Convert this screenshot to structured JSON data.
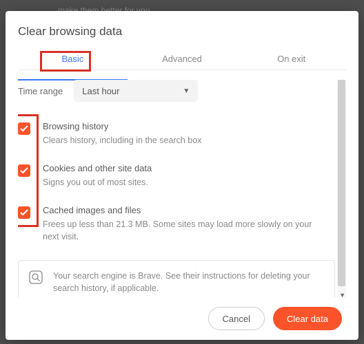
{
  "background": {
    "hint_text": "make them better for you."
  },
  "dialog": {
    "title": "Clear browsing data",
    "tabs": {
      "basic": "Basic",
      "advanced": "Advanced",
      "on_exit": "On exit"
    },
    "time_range": {
      "label": "Time range",
      "selected": "Last hour"
    },
    "items": [
      {
        "title": "Browsing history",
        "desc": "Clears history, including in the search box"
      },
      {
        "title": "Cookies and other site data",
        "desc": "Signs you out of most sites."
      },
      {
        "title": "Cached images and files",
        "desc": "Frees up less than 21.3 MB. Some sites may load more slowly on your next visit."
      }
    ],
    "info": "Your search engine is Brave. See their instructions for deleting your search history, if applicable.",
    "buttons": {
      "cancel": "Cancel",
      "confirm": "Clear data"
    }
  }
}
